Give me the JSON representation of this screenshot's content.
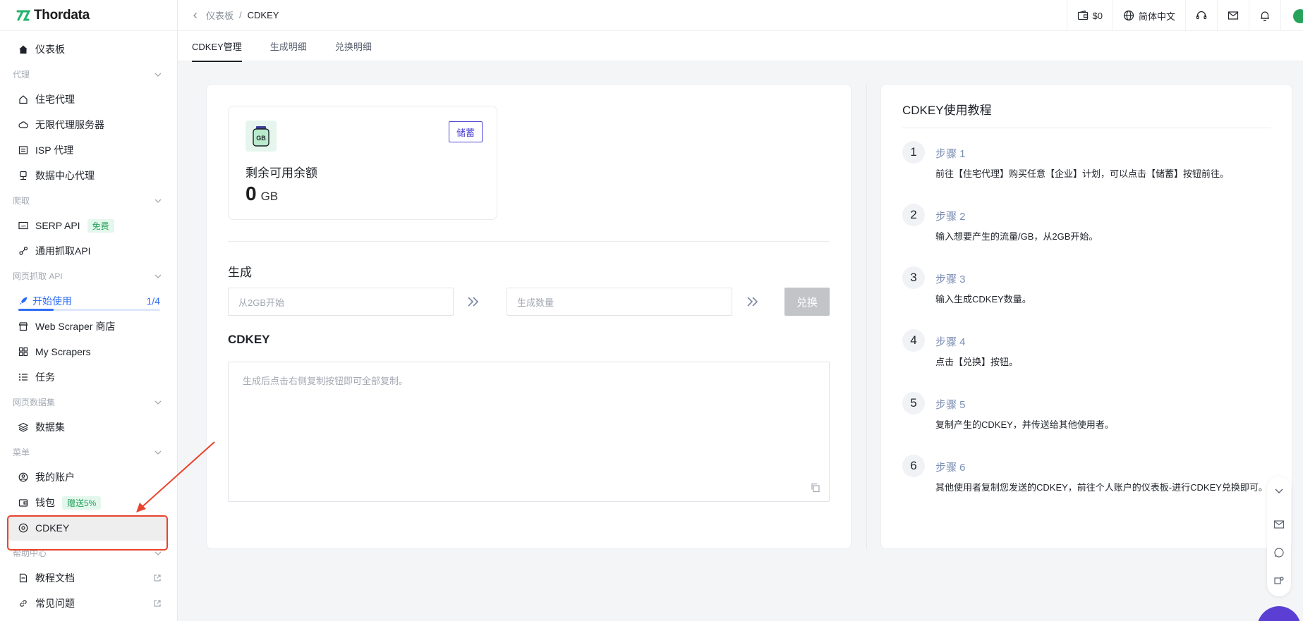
{
  "brand": {
    "name": "Thordata",
    "accent": "#2e6cf6",
    "logo_color": "#21b36b"
  },
  "sidebar": {
    "dashboard": "仪表板",
    "sections": {
      "proxy": "代理",
      "scrape": "爬取",
      "web_api": "网页抓取 API",
      "dataset": "网页数据集",
      "menu": "菜单",
      "help": "帮助中心"
    },
    "items": {
      "residential": "住宅代理",
      "unlimited": "无限代理服务器",
      "isp": "ISP 代理",
      "datacenter": "数据中心代理",
      "serp": "SERP API",
      "serp_badge": "免费",
      "universal": "通用抓取API",
      "start": "开始使用",
      "start_progress": "1/4",
      "store": "Web Scraper 商店",
      "my_scrapers": "My Scrapers",
      "tasks": "任务",
      "datasets": "数据集",
      "account": "我的账户",
      "wallet": "钱包",
      "wallet_badge": "赠送5%",
      "cdkey": "CDKEY",
      "docs": "教程文档",
      "faq": "常见问题"
    },
    "start_progress_fraction": 0.25
  },
  "topbar": {
    "breadcrumb_root": "仪表板",
    "breadcrumb_sep": "/",
    "breadcrumb_current": "CDKEY",
    "balance": "$0",
    "language": "简体中文"
  },
  "tabs": [
    "CDKEY管理",
    "生成明细",
    "兑换明细"
  ],
  "balance_card": {
    "icon_text": "GB",
    "store_button": "储蓄",
    "label": "剩余可用余额",
    "value": "0",
    "unit": "GB"
  },
  "generate": {
    "title": "生成",
    "traffic_placeholder": "从2GB开始",
    "count_placeholder": "生成数量",
    "exchange_button": "兑换",
    "cdkey_title": "CDKEY",
    "textarea_placeholder": "生成后点击右侧复制按钮即可全部复制。"
  },
  "tutorial": {
    "title": "CDKEY使用教程",
    "steps": [
      {
        "num": "1",
        "title": "步骤 1",
        "desc": "前往【住宅代理】购买任意【企业】计划，可以点击【储蓄】按钮前往。"
      },
      {
        "num": "2",
        "title": "步骤 2",
        "desc": "输入想要产生的流量/GB，从2GB开始。"
      },
      {
        "num": "3",
        "title": "步骤 3",
        "desc": "输入生成CDKEY数量。"
      },
      {
        "num": "4",
        "title": "步骤 4",
        "desc": "点击【兑换】按钮。"
      },
      {
        "num": "5",
        "title": "步骤 5",
        "desc": "复制产生的CDKEY，并传送给其他使用者。"
      },
      {
        "num": "6",
        "title": "步骤 6",
        "desc": "其他使用者复制您发送的CDKEY，前往个人账户的仪表板-进行CDKEY兑换即可。"
      }
    ]
  },
  "colors": {
    "highlight": "#e8442d",
    "store_button": "#5147d6",
    "step_title": "#7b8fb5"
  }
}
